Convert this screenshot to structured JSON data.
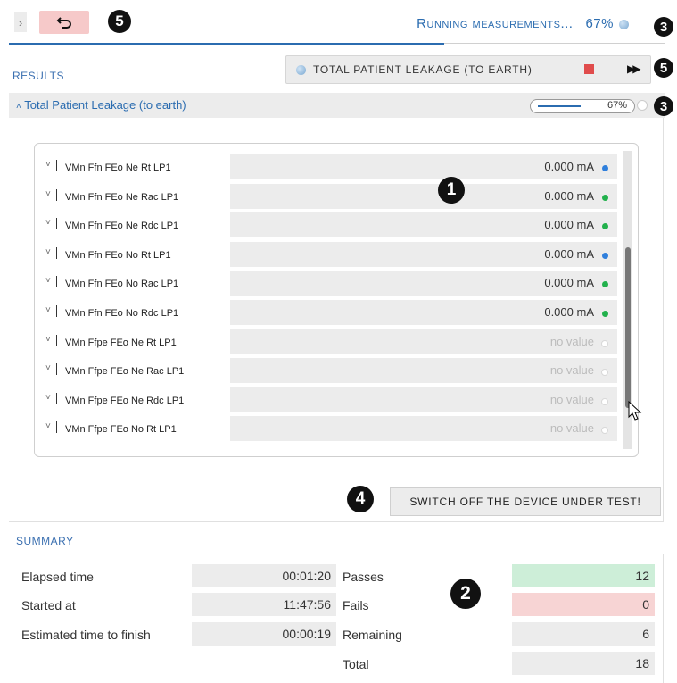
{
  "header": {
    "status_text": "Running measurements...",
    "progress_percent": "67%",
    "progress_fraction": 0.67
  },
  "results": {
    "section_label": "RESULTS",
    "current_test": "TOTAL PATIENT LEAKAGE (TO EARTH)",
    "group_title": "Total Patient Leakage (to earth)",
    "group_progress": "67%",
    "rows": [
      {
        "name": "VMn Ffn FEo Ne Rt LP1",
        "value": "0.000 mA",
        "status": "blue"
      },
      {
        "name": "VMn Ffn FEo Ne Rac LP1",
        "value": "0.000 mA",
        "status": "green"
      },
      {
        "name": "VMn Ffn FEo Ne Rdc LP1",
        "value": "0.000 mA",
        "status": "green"
      },
      {
        "name": "VMn Ffn FEo No Rt LP1",
        "value": "0.000 mA",
        "status": "blue"
      },
      {
        "name": "VMn Ffn FEo No Rac LP1",
        "value": "0.000 mA",
        "status": "green"
      },
      {
        "name": "VMn Ffn FEo No Rdc LP1",
        "value": "0.000 mA",
        "status": "green"
      },
      {
        "name": "VMn Ffpe FEo Ne Rt LP1",
        "value": "no value",
        "status": "empty"
      },
      {
        "name": "VMn Ffpe FEo Ne Rac LP1",
        "value": "no value",
        "status": "empty"
      },
      {
        "name": "VMn Ffpe FEo Ne Rdc LP1",
        "value": "no value",
        "status": "empty"
      },
      {
        "name": "VMn Ffpe FEo No Rt LP1",
        "value": "no value",
        "status": "empty"
      }
    ],
    "instruction_button": "SWITCH OFF THE DEVICE UNDER TEST!"
  },
  "summary": {
    "section_label": "SUMMARY",
    "elapsed_label": "Elapsed time",
    "elapsed_value": "00:01:20",
    "started_label": "Started at",
    "started_value": "11:47:56",
    "eta_label": "Estimated time to finish",
    "eta_value": "00:00:19",
    "passes_label": "Passes",
    "passes_value": "12",
    "fails_label": "Fails",
    "fails_value": "0",
    "remaining_label": "Remaining",
    "remaining_value": "6",
    "total_label": "Total",
    "total_value": "18"
  },
  "callouts": {
    "c1": "1",
    "c2": "2",
    "c3a": "3",
    "c3b": "3",
    "c4": "4",
    "c5a": "5",
    "c5b": "5"
  },
  "colors": {
    "accent": "#2b6cb0",
    "pass": "#22b14c",
    "running": "#2f7fdc",
    "stop": "#e04c4c",
    "pass_bg": "#cdeed8",
    "fail_bg": "#f7d4d4"
  }
}
